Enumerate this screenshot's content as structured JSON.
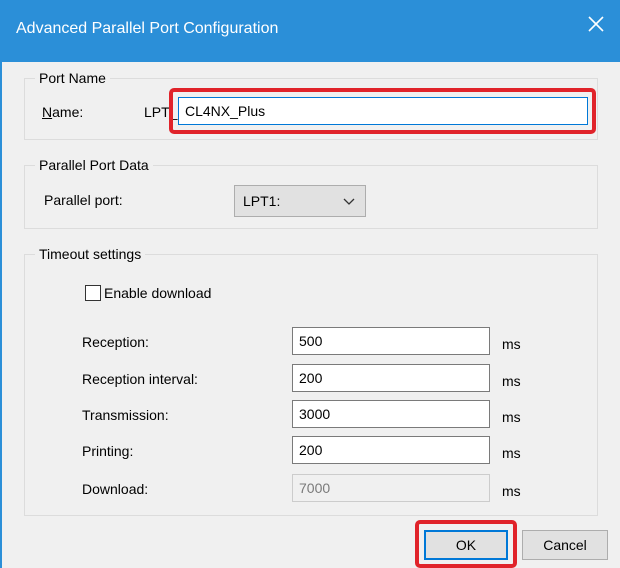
{
  "window": {
    "title": "Advanced Parallel Port Configuration",
    "close_icon": "close-icon"
  },
  "port_name": {
    "group_label": "Port Name",
    "name_label_accel": "N",
    "name_label_rest": "ame:",
    "prefix": "LPT_",
    "value": "CL4NX_Plus"
  },
  "parallel_port_data": {
    "group_label": "Parallel Port Data",
    "port_label": "Parallel port:",
    "port_value": "LPT1:"
  },
  "timeout_settings": {
    "group_label": "Timeout settings",
    "enable_download": {
      "label": "Enable download",
      "checked": false
    },
    "rows": [
      {
        "label": "Reception:",
        "value": "500",
        "unit": "ms",
        "enabled": true
      },
      {
        "label": "Reception interval:",
        "value": "200",
        "unit": "ms",
        "enabled": true
      },
      {
        "label": "Transmission:",
        "value": "3000",
        "unit": "ms",
        "enabled": true
      },
      {
        "label": "Printing:",
        "value": "200",
        "unit": "ms",
        "enabled": true
      },
      {
        "label": "Download:",
        "value": "7000",
        "unit": "ms",
        "enabled": false
      }
    ]
  },
  "buttons": {
    "ok": "OK",
    "cancel": "Cancel"
  },
  "colors": {
    "titlebar": "#2b8fd8",
    "highlight_box": "#e0232a",
    "focus_border": "#0078d7"
  }
}
